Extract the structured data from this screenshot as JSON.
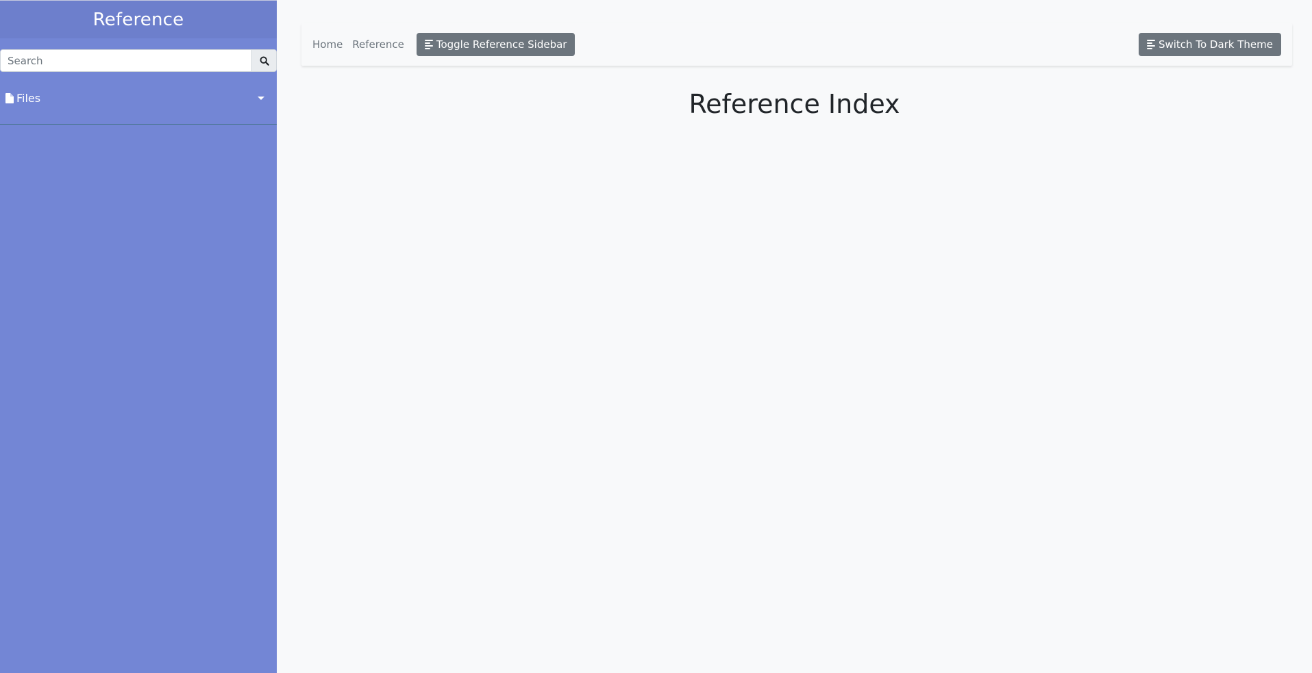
{
  "sidebar": {
    "title": "Reference",
    "search": {
      "placeholder": "Search",
      "value": "",
      "button_icon": "search-icon"
    },
    "files": {
      "label": "Files",
      "icon": "file-icon",
      "toggle_icon": "caret-down-icon"
    }
  },
  "topbar": {
    "links": [
      {
        "label": "Home"
      },
      {
        "label": "Reference"
      }
    ],
    "toggle_sidebar_label": "Toggle Reference Sidebar",
    "toggle_sidebar_icon": "align-left-icon",
    "theme_label": "Switch To Dark Theme",
    "theme_icon": "align-left-icon"
  },
  "main": {
    "title": "Reference Index"
  },
  "colors": {
    "sidebar_bg": "#7386d5",
    "sidebar_header_bg": "#6d7fcc",
    "page_bg": "#f8f9fa",
    "button_bg": "#6c757d",
    "title_text": "#212529"
  }
}
